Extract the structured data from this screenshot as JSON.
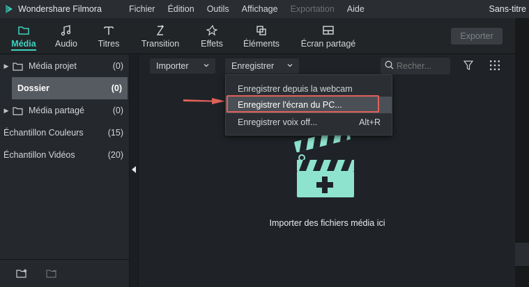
{
  "app": {
    "name": "Wondershare Filmora",
    "document_title": "Sans-titre"
  },
  "menu": [
    {
      "label": "Fichier",
      "enabled": true
    },
    {
      "label": "Édition",
      "enabled": true
    },
    {
      "label": "Outils",
      "enabled": true
    },
    {
      "label": "Affichage",
      "enabled": true
    },
    {
      "label": "Exportation",
      "enabled": false
    },
    {
      "label": "Aide",
      "enabled": true
    }
  ],
  "tabs": [
    {
      "label": "Média",
      "icon": "folder-icon",
      "active": true
    },
    {
      "label": "Audio",
      "icon": "music-note-icon"
    },
    {
      "label": "Titres",
      "icon": "text-icon"
    },
    {
      "label": "Transition",
      "icon": "transition-icon"
    },
    {
      "label": "Effets",
      "icon": "effects-icon"
    },
    {
      "label": "Éléments",
      "icon": "elements-icon"
    },
    {
      "label": "Écran partagé",
      "icon": "split-screen-icon"
    }
  ],
  "export_label": "Exporter",
  "library": [
    {
      "label": "Média projet",
      "count": "(0)",
      "has_arrow": true,
      "has_folder": true
    },
    {
      "label": "Dossier",
      "count": "(0)",
      "selected": true
    },
    {
      "label": "Média partagé",
      "count": "(0)",
      "has_arrow": true,
      "has_folder": true
    },
    {
      "label": "Échantillon Couleurs",
      "count": "(15)"
    },
    {
      "label": "Échantillon Vidéos",
      "count": "(20)"
    }
  ],
  "media_toolbar": {
    "import_label": "Importer",
    "record_label": "Enregistrer",
    "search_placeholder": "Recher..."
  },
  "record_menu": [
    {
      "label": "Enregistrer depuis la webcam",
      "shortcut": ""
    },
    {
      "label": "Enregistrer l'écran du PC...",
      "shortcut": "",
      "highlighted": true
    },
    {
      "label": "Enregistrer voix off...",
      "shortcut": "Alt+R"
    }
  ],
  "empty_state": {
    "text": "Importer des fichiers média ici"
  },
  "colors": {
    "accent": "#3fd1c0",
    "annotation": "#e0615a",
    "illustration": "#8ee3cf"
  }
}
